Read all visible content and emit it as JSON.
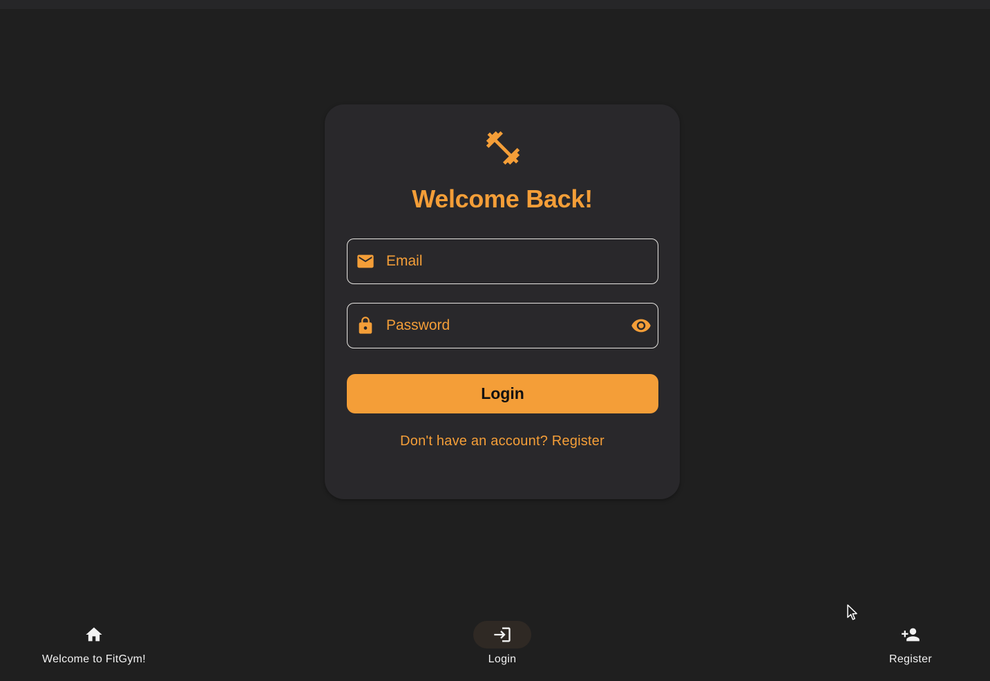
{
  "login_card": {
    "title": "Welcome Back!",
    "logo_icon": "fitness-dumbbell-icon",
    "email_field": {
      "placeholder": "Email",
      "value": "",
      "icon": "mail-icon"
    },
    "password_field": {
      "placeholder": "Password",
      "value": "",
      "icon": "lock-icon",
      "toggle_icon": "eye-icon"
    },
    "login_button_label": "Login",
    "register_prompt": "Don't have an account? Register"
  },
  "bottom_nav": {
    "items": [
      {
        "label": "Welcome to FitGym!",
        "icon": "home-icon",
        "active": false
      },
      {
        "label": "Login",
        "icon": "login-icon",
        "active": true
      },
      {
        "label": "Register",
        "icon": "person-add-icon",
        "active": false
      }
    ]
  },
  "colors": {
    "background": "#1f1f1f",
    "card": "#29282b",
    "accent": "#f49e38",
    "nav_text": "#f2f2f2"
  }
}
